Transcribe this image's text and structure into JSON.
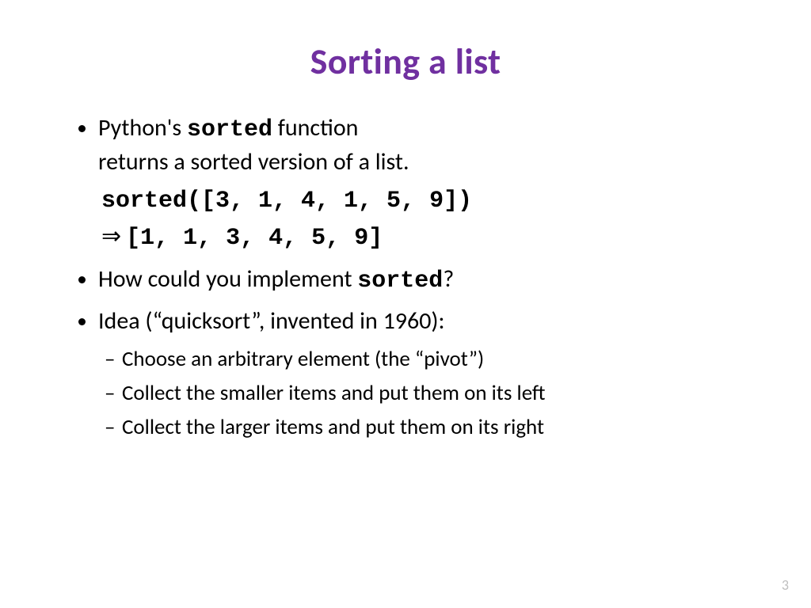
{
  "title": "Sorting a list",
  "bullet1": {
    "lead": "Python's ",
    "mono": "sorted",
    "tail": " function"
  },
  "bullet1_line2": "returns a sorted version of a list.",
  "code": {
    "call": "sorted([3, 1, 4, 1, 5, 9])",
    "arrow": "⇒",
    "result": "[1, 1, 3, 4, 5, 9]"
  },
  "bullet2": {
    "lead": "How could you implement ",
    "mono": "sorted",
    "tail": "?"
  },
  "bullet3": "Idea (“quicksort”, invented in 1960):",
  "sub": [
    "Choose an arbitrary element (the “pivot”)",
    "Collect the smaller items and put them on its left",
    "Collect the larger items and put them on its right"
  ],
  "page_num": "3"
}
